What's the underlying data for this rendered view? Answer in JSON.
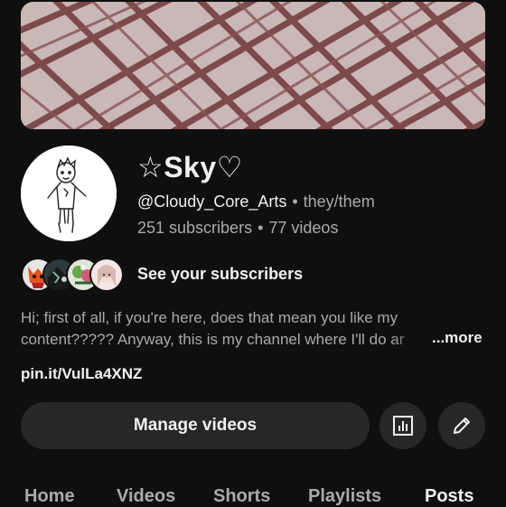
{
  "channel": {
    "name": "☆Sky♡",
    "handle": "@Cloudy_Core_Arts",
    "pronouns": "they/them",
    "subscribers": "251 subscribers",
    "videos": "77 videos",
    "separator": "•"
  },
  "subscribers_preview": {
    "label": "See your subscribers",
    "avatars": [
      "subscriber-avatar-fox",
      "subscriber-avatar-dark",
      "subscriber-avatar-green",
      "subscriber-avatar-pink"
    ]
  },
  "description": {
    "line1": "Hi; first of all, if you're here, does that mean you like my",
    "line2": "content????? Anyway, this is my channel where I'll do ar",
    "more_label": "...more"
  },
  "link": "pin.it/VulLa4XNZ",
  "actions": {
    "manage_videos": "Manage videos",
    "analytics_icon": "analytics-icon",
    "edit_icon": "pencil-icon"
  },
  "tabs": [
    {
      "label": "Home",
      "active": false
    },
    {
      "label": "Videos",
      "active": false
    },
    {
      "label": "Shorts",
      "active": false
    },
    {
      "label": "Playlists",
      "active": false
    },
    {
      "label": "Posts",
      "active": true
    }
  ],
  "colors": {
    "background": "#0f0f0f",
    "banner_base": "#c7b4b1",
    "banner_lines": "#7a4446",
    "button_bg": "#272727",
    "secondary_text": "#aaaaaa"
  }
}
